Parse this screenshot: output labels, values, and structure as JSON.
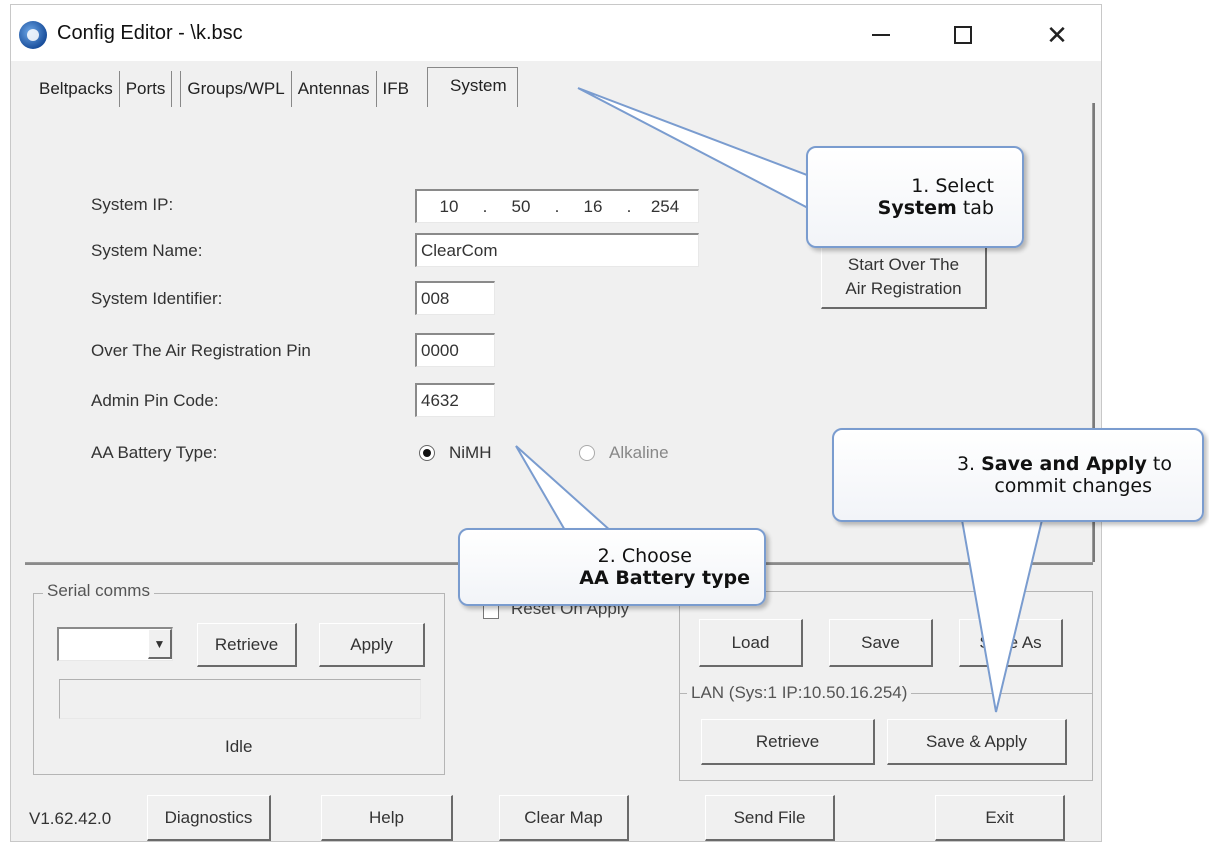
{
  "window": {
    "title": "Config Editor - \\k.bsc",
    "controls": {
      "minimize": "—",
      "maximize": "☐",
      "close": "✕"
    }
  },
  "tabs": [
    "Beltpacks",
    "Ports",
    "Groups/WPL",
    "Antennas",
    "IFB",
    "System"
  ],
  "active_tab": "System",
  "system": {
    "ip_label": "System IP:",
    "ip": [
      "10",
      "50",
      "16",
      "254"
    ],
    "ip_sep": ".",
    "name_label": "System Name:",
    "name": "ClearCom",
    "identifier_label": "System Identifier:",
    "identifier": "008",
    "ota_pin_label": "Over The Air Registration Pin",
    "ota_pin": "0000",
    "admin_pin_label": "Admin Pin Code:",
    "admin_pin": "4632",
    "battery_label": "AA Battery Type:",
    "battery_options": [
      "NiMH",
      "Alkaline"
    ],
    "battery_selected": "NiMH",
    "start_over_line1": "Start Over The",
    "start_over_line2": "Air Registration"
  },
  "serial": {
    "title": "Serial comms",
    "retrieve": "Retrieve",
    "apply": "Apply",
    "status": "Idle"
  },
  "reset_on_apply": "Reset On Apply",
  "file": {
    "load": "Load",
    "save": "Save",
    "save_as": "Save As"
  },
  "lan": {
    "title": "LAN  (Sys:1 IP:10.50.16.254)",
    "retrieve": "Retrieve",
    "save_apply": "Save & Apply"
  },
  "footer": {
    "version": "V1.62.42.0",
    "diagnostics": "Diagnostics",
    "help": "Help",
    "clear_map": "Clear Map",
    "send_file": "Send File",
    "exit": "Exit"
  },
  "callouts": {
    "c1_line1": "1. Select",
    "c1_bold": "System",
    "c1_rest": " tab",
    "c2_line1": "2. Choose",
    "c2_bold": "AA Battery type",
    "c3_num": "3. ",
    "c3_bold": "Save and Apply",
    "c3_rest": " to",
    "c3_line2": "commit changes"
  },
  "colors": {
    "callout_border": "#7a9ccf",
    "window_bg": "#f0f0f0"
  }
}
